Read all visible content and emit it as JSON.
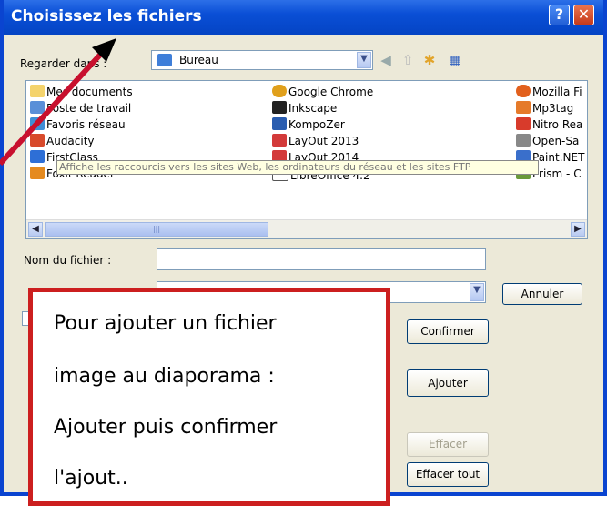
{
  "dialog": {
    "title": "Choisissez les fichiers",
    "look_in_label": "Regarder dans :",
    "look_in_value": "Bureau",
    "tooltip": "Affiche les raccourcis vers les sites Web, les ordinateurs du réseau et les sites FTP",
    "filename_label": "Nom du fichier :",
    "filename_value": ""
  },
  "files": {
    "col1": [
      "Mes documents",
      "Poste de travail",
      "Favoris réseau",
      "Audacity",
      "FirstClass",
      "Foxit Reader"
    ],
    "col2": [
      "Google Chrome",
      "Inkscape",
      "KompoZer",
      "LayOut 2013",
      "LayOut 2014",
      "LibreOffice 4.2"
    ],
    "col3": [
      "Mozilla Fi",
      "Mp3tag",
      "Nitro Rea",
      "Open-Sa",
      "Paint.NET",
      "Prism - C"
    ]
  },
  "buttons": {
    "annuler": "Annuler",
    "confirmer": "Confirmer",
    "ajouter": "Ajouter",
    "effacer": "Effacer",
    "effacer_tout": "Effacer tout"
  },
  "callout": {
    "line1": "Pour ajouter un fichier",
    "line2": "image au diaporama :",
    "line3": "Ajouter puis confirmer",
    "line4": "l'ajout.."
  },
  "colors": {
    "titlebar": "#0a4fd6",
    "callout_border": "#cc1f1f",
    "arrow": "#c8102e"
  },
  "icons": {
    "help": "?",
    "close": "✕"
  }
}
